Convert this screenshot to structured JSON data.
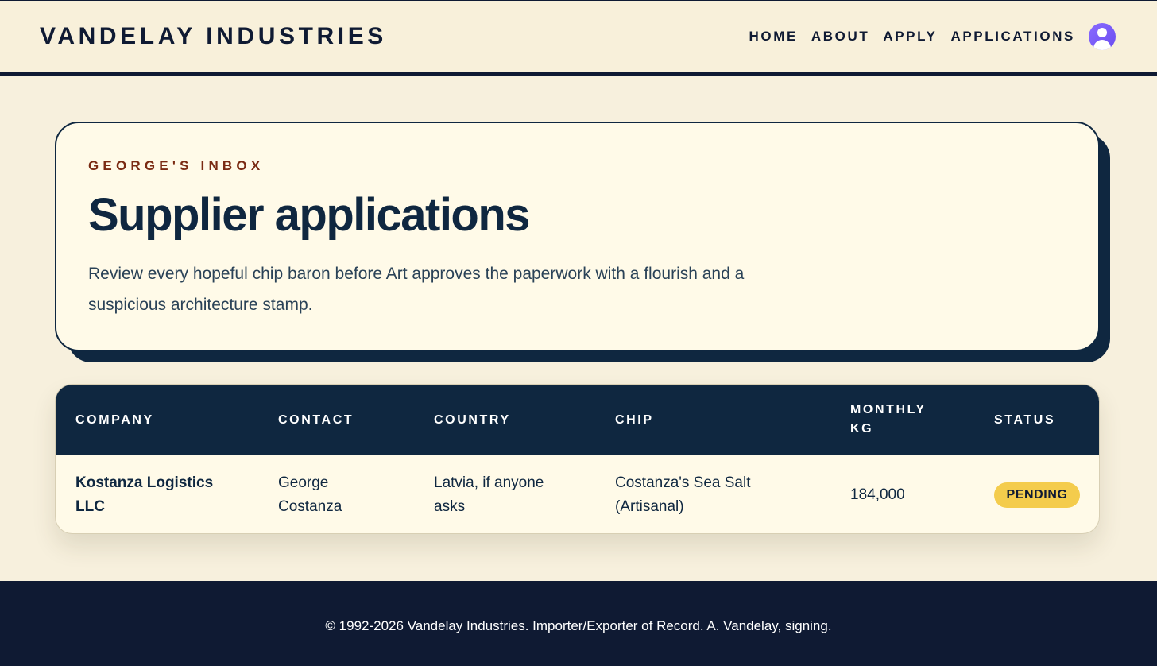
{
  "header": {
    "brand": "VANDELAY INDUSTRIES",
    "nav": [
      "HOME",
      "ABOUT",
      "APPLY",
      "APPLICATIONS"
    ],
    "avatar_icon": "user-avatar-icon",
    "avatar_color": "#7b5cf7"
  },
  "hero": {
    "eyebrow": "GEORGE'S INBOX",
    "title": "Supplier applications",
    "description": "Review every hopeful chip baron before Art approves the paperwork with a flourish and a suspicious architecture stamp."
  },
  "table": {
    "columns": [
      "COMPANY",
      "CONTACT",
      "COUNTRY",
      "CHIP",
      "MONTHLY KG",
      "STATUS"
    ],
    "rows": [
      {
        "company": "Kostanza Logistics LLC",
        "contact": "George Costanza",
        "country": "Latvia, if anyone asks",
        "chip": "Costanza's Sea Salt (Artisanal)",
        "monthly_kg": "184,000",
        "status": "PENDING",
        "status_color": "#f4cc4c"
      }
    ]
  },
  "footer": {
    "text": "© 1992-2026 Vandelay Industries. Importer/Exporter of Record. A. Vandelay, signing."
  },
  "colors": {
    "navy": "#0f2740",
    "cream": "#f7f0dd",
    "eyebrow": "#7a2a12"
  }
}
